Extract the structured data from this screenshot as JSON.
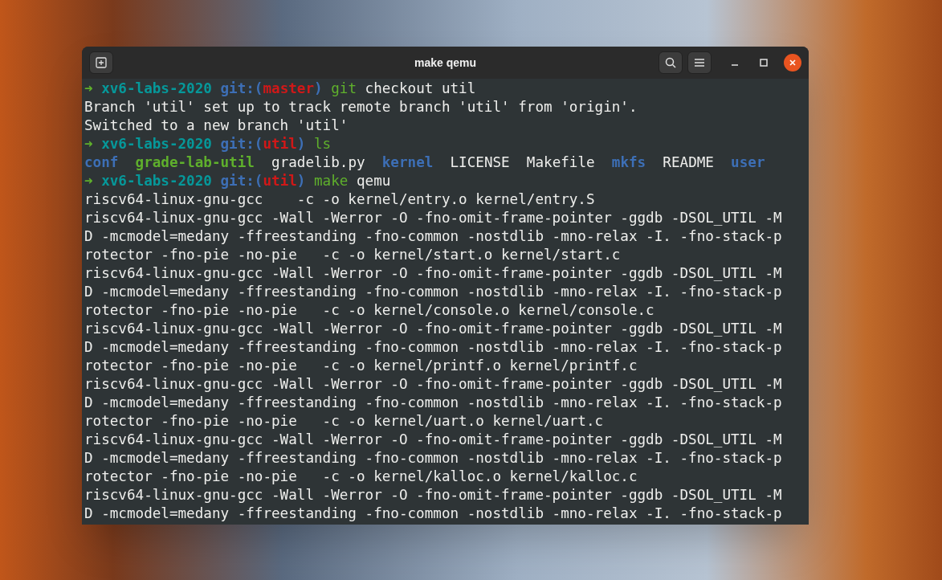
{
  "window": {
    "title": "make qemu"
  },
  "terminal": {
    "lines": [
      {
        "kind": "prompt",
        "segments": [
          {
            "kind": "arrow",
            "text": "➜"
          },
          {
            "kind": "dir",
            "text": "xv6-labs-2020"
          },
          {
            "kind": "git",
            "text": "git:("
          },
          {
            "kind": "branch",
            "text": "master"
          },
          {
            "kind": "git",
            "text": ")"
          },
          {
            "kind": "cmd",
            "text": "git"
          },
          {
            "kind": "plain",
            "text": "checkout util"
          }
        ]
      },
      {
        "kind": "output",
        "text": "Branch 'util' set up to track remote branch 'util' from 'origin'."
      },
      {
        "kind": "output",
        "text": "Switched to a new branch 'util'"
      },
      {
        "kind": "prompt",
        "segments": [
          {
            "kind": "arrow",
            "text": "➜"
          },
          {
            "kind": "dir",
            "text": "xv6-labs-2020"
          },
          {
            "kind": "git",
            "text": "git:("
          },
          {
            "kind": "branch",
            "text": "util"
          },
          {
            "kind": "git",
            "text": ")"
          },
          {
            "kind": "cmd",
            "text": "ls"
          }
        ]
      },
      {
        "kind": "listing",
        "entries": [
          {
            "kind": "dir",
            "text": "conf"
          },
          {
            "kind": "exec",
            "text": "grade-lab-util"
          },
          {
            "kind": "file",
            "text": "gradelib.py"
          },
          {
            "kind": "dir",
            "text": "kernel"
          },
          {
            "kind": "file",
            "text": "LICENSE"
          },
          {
            "kind": "file",
            "text": "Makefile"
          },
          {
            "kind": "dir",
            "text": "mkfs"
          },
          {
            "kind": "file",
            "text": "README"
          },
          {
            "kind": "dir",
            "text": "user"
          }
        ]
      },
      {
        "kind": "prompt",
        "segments": [
          {
            "kind": "arrow",
            "text": "➜"
          },
          {
            "kind": "dir",
            "text": "xv6-labs-2020"
          },
          {
            "kind": "git",
            "text": "git:("
          },
          {
            "kind": "branch",
            "text": "util"
          },
          {
            "kind": "git",
            "text": ")"
          },
          {
            "kind": "cmd",
            "text": "make"
          },
          {
            "kind": "plain",
            "text": "qemu"
          }
        ]
      },
      {
        "kind": "output",
        "text": "riscv64-linux-gnu-gcc    -c -o kernel/entry.o kernel/entry.S"
      },
      {
        "kind": "output",
        "text": "riscv64-linux-gnu-gcc -Wall -Werror -O -fno-omit-frame-pointer -ggdb -DSOL_UTIL -M"
      },
      {
        "kind": "output",
        "text": "D -mcmodel=medany -ffreestanding -fno-common -nostdlib -mno-relax -I. -fno-stack-p"
      },
      {
        "kind": "output",
        "text": "rotector -fno-pie -no-pie   -c -o kernel/start.o kernel/start.c"
      },
      {
        "kind": "output",
        "text": "riscv64-linux-gnu-gcc -Wall -Werror -O -fno-omit-frame-pointer -ggdb -DSOL_UTIL -M"
      },
      {
        "kind": "output",
        "text": "D -mcmodel=medany -ffreestanding -fno-common -nostdlib -mno-relax -I. -fno-stack-p"
      },
      {
        "kind": "output",
        "text": "rotector -fno-pie -no-pie   -c -o kernel/console.o kernel/console.c"
      },
      {
        "kind": "output",
        "text": "riscv64-linux-gnu-gcc -Wall -Werror -O -fno-omit-frame-pointer -ggdb -DSOL_UTIL -M"
      },
      {
        "kind": "output",
        "text": "D -mcmodel=medany -ffreestanding -fno-common -nostdlib -mno-relax -I. -fno-stack-p"
      },
      {
        "kind": "output",
        "text": "rotector -fno-pie -no-pie   -c -o kernel/printf.o kernel/printf.c"
      },
      {
        "kind": "output",
        "text": "riscv64-linux-gnu-gcc -Wall -Werror -O -fno-omit-frame-pointer -ggdb -DSOL_UTIL -M"
      },
      {
        "kind": "output",
        "text": "D -mcmodel=medany -ffreestanding -fno-common -nostdlib -mno-relax -I. -fno-stack-p"
      },
      {
        "kind": "output",
        "text": "rotector -fno-pie -no-pie   -c -o kernel/uart.o kernel/uart.c"
      },
      {
        "kind": "output",
        "text": "riscv64-linux-gnu-gcc -Wall -Werror -O -fno-omit-frame-pointer -ggdb -DSOL_UTIL -M"
      },
      {
        "kind": "output",
        "text": "D -mcmodel=medany -ffreestanding -fno-common -nostdlib -mno-relax -I. -fno-stack-p"
      },
      {
        "kind": "output",
        "text": "rotector -fno-pie -no-pie   -c -o kernel/kalloc.o kernel/kalloc.c"
      },
      {
        "kind": "output",
        "text": "riscv64-linux-gnu-gcc -Wall -Werror -O -fno-omit-frame-pointer -ggdb -DSOL_UTIL -M"
      },
      {
        "kind": "output",
        "text": "D -mcmodel=medany -ffreestanding -fno-common -nostdlib -mno-relax -I. -fno-stack-p"
      }
    ]
  }
}
